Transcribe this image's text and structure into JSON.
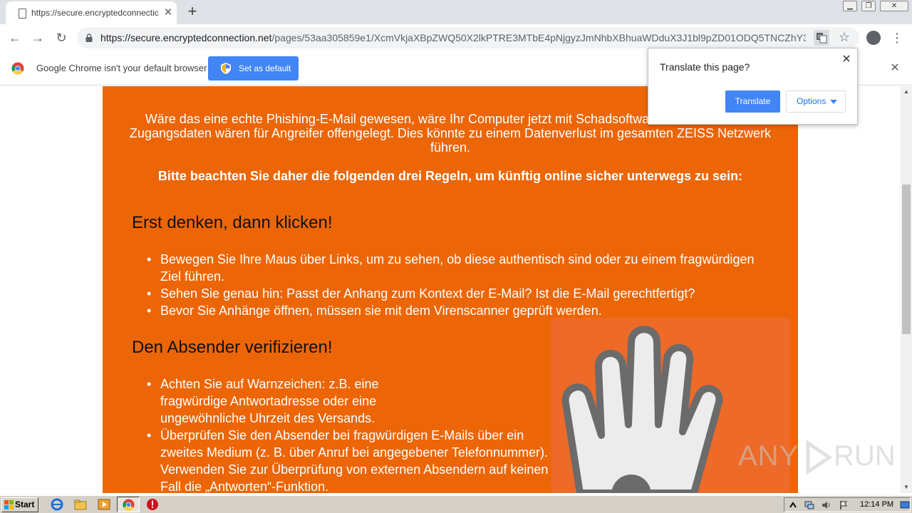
{
  "browser": {
    "tab": {
      "title": "https://secure.encryptedconnection",
      "close": "✕"
    },
    "new_tab": "+",
    "window_controls": {
      "minimize": "▁",
      "restore": "❐",
      "close": "✕"
    },
    "nav": {
      "back": "←",
      "forward": "→",
      "reload": "↻"
    },
    "url": {
      "host": "https://secure.encryptedconnection.net",
      "path": "/pages/53aa305859e1/XcmVkjaXBpZWQ50X2lkPTRE3MTbE4pNjgyzJmNhbXBhuaWDduX3J1bl9pZD01ODQ5TNCZhY3..."
    },
    "star": "☆",
    "menu": "⋮"
  },
  "infobar": {
    "message": "Google Chrome isn't your default browser",
    "set_default_label": "Set as default",
    "close": "✕"
  },
  "translate_popup": {
    "title": "Translate this page?",
    "translate_label": "Translate",
    "options_label": "Options",
    "close": "✕"
  },
  "page": {
    "intro": "Wäre das eine echte Phishing-E-Mail gewesen, wäre Ihr Computer jetzt mit Schadsoftware infiziert und Ihre Zugangsdaten wären für Angreifer offengelegt. Dies könnte zu einem Datenverlust im gesamten ZEISS Netzwerk führen.",
    "rules_heading": "Bitte beachten Sie daher die folgenden drei Regeln, um künftig online sicher unterwegs zu sein:",
    "sections": [
      {
        "heading": "Erst denken, dann klicken!",
        "bullets": [
          "Bewegen Sie Ihre Maus über Links, um zu sehen, ob diese authentisch sind oder zu einem fragwürdigen Ziel führen.",
          "Sehen Sie genau hin: Passt der Anhang zum Kontext der E-Mail? Ist die E-Mail gerechtfertigt?",
          "Bevor Sie Anhänge öffnen, müssen sie mit dem Virenscanner geprüft werden."
        ]
      },
      {
        "heading": "Den Absender verifizieren!",
        "bullets": [
          "Achten Sie auf Warnzeichen: z.B. eine fragwürdige Antwortadresse oder eine ungewöhnliche Uhrzeit des Versands.",
          "Überprüfen Sie den Absender bei fragwürdigen E-Mails über ein zweites Medium (z. B. über Anruf bei angegebener Telefonnummer). Verwenden Sie zur Überprüfung von externen Absendern auf keinen Fall die „Antworten“-Funktion."
        ]
      }
    ],
    "colors": {
      "panel": "#ec6608",
      "hand_box": "#ed6a28",
      "heading_text": "#111111"
    }
  },
  "watermark": {
    "left": "ANY",
    "right": "RUN"
  },
  "taskbar": {
    "start_label": "Start",
    "clock": "12:14 PM",
    "icons": [
      "ie-icon",
      "explorer-icon",
      "media-player-icon",
      "chrome-icon",
      "stop-icon"
    ]
  },
  "scrollbar": {
    "up": "▲",
    "down": "▼"
  }
}
